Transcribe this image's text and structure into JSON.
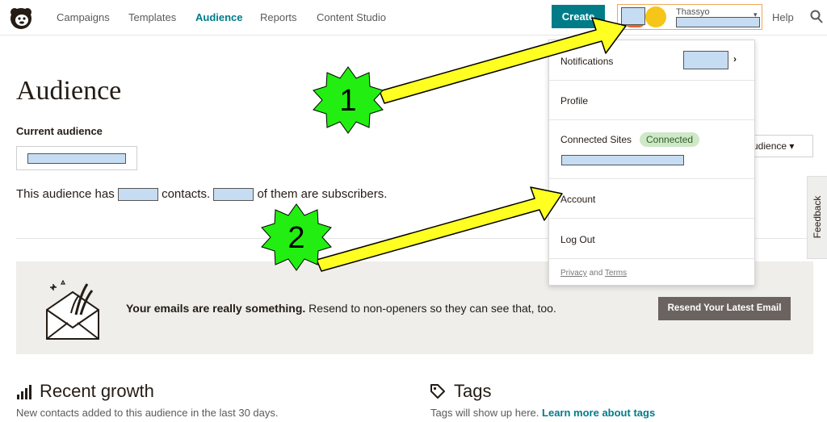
{
  "nav": {
    "links": [
      "Campaigns",
      "Templates",
      "Audience",
      "Reports",
      "Content Studio"
    ],
    "active": "Audience",
    "create_label": "Create",
    "help_label": "Help",
    "account_name": "Thassyo"
  },
  "page": {
    "title": "Audience",
    "current_audience_label": "Current audience",
    "summary_prefix": "This audience has",
    "summary_mid": "contacts.",
    "summary_suffix": "of them are subscribers.",
    "manage_partial": "udience"
  },
  "feedback_label": "Feedback",
  "banner": {
    "bold_text": "Your emails are really something.",
    "text": " Resend to non-openers so they can see that, too.",
    "button_label": "Resend Your Latest Email"
  },
  "growth": {
    "title": "Recent growth",
    "subtitle": "New contacts added to this audience in the last 30 days."
  },
  "tags": {
    "title": "Tags",
    "subtitle": "Tags will show up here.",
    "link": "Learn more about tags"
  },
  "dropdown": {
    "notifications": "Notifications",
    "profile": "Profile",
    "connected_sites": "Connected Sites",
    "connected_badge": "Connected",
    "account": "Account",
    "logout": "Log Out",
    "privacy": "Privacy",
    "and": "and",
    "terms": "Terms"
  },
  "annotations": {
    "step1": "1",
    "step2": "2",
    "star_color": "#22ee11",
    "arrow_color": "#ffff22"
  },
  "colors": {
    "accent": "#007c89",
    "highlight_border": "#f2a65a",
    "redaction": "#c6dcf2"
  }
}
